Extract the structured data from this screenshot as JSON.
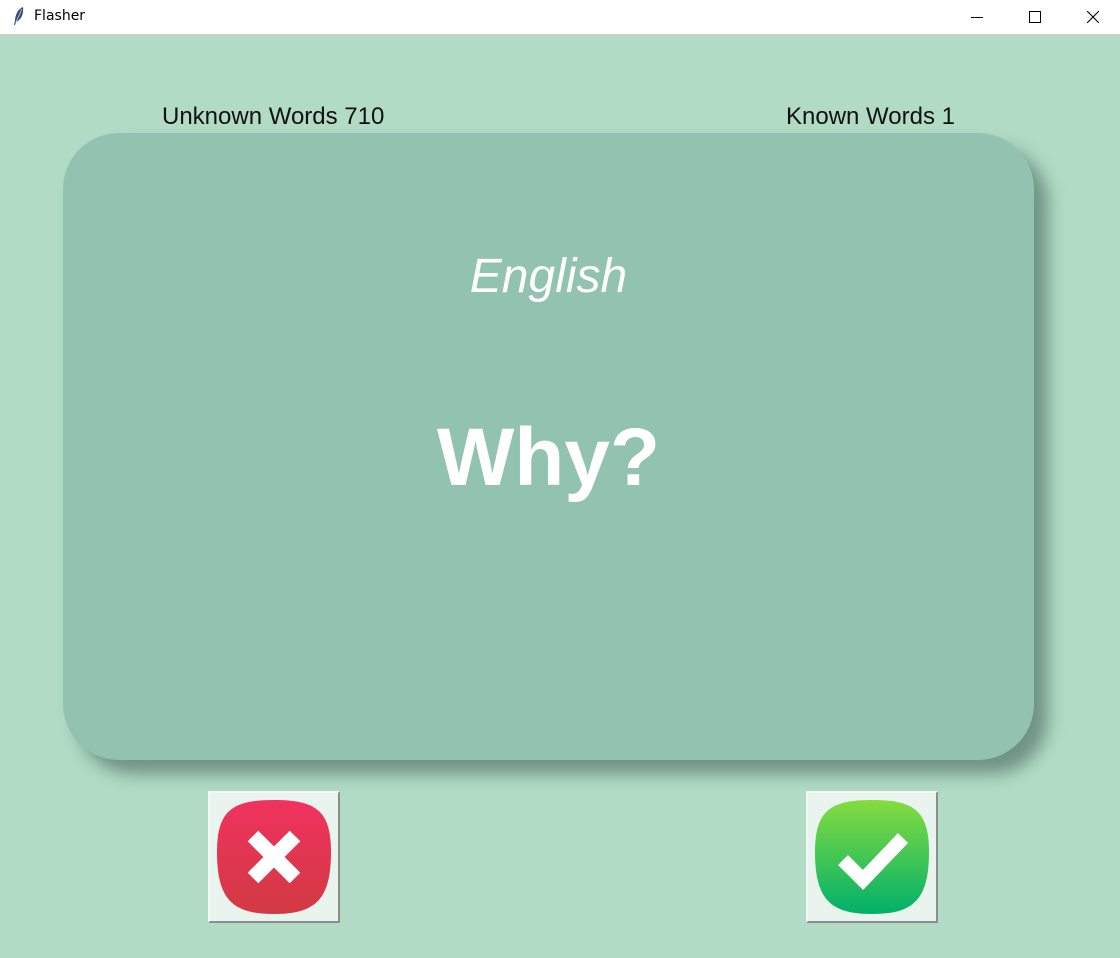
{
  "window": {
    "title": "Flasher",
    "icon": "feather-icon"
  },
  "counters": {
    "unknown_label": "Unknown Words 710",
    "known_label": "Known Words 1"
  },
  "card": {
    "language": "English",
    "word": "Why?"
  },
  "buttons": {
    "wrong_icon": "x-icon",
    "right_icon": "checkmark-icon"
  },
  "colors": {
    "background": "#b1dbc5",
    "card": "#92c2b0",
    "wrong": "#e3385a",
    "right": "#2fc25b"
  }
}
